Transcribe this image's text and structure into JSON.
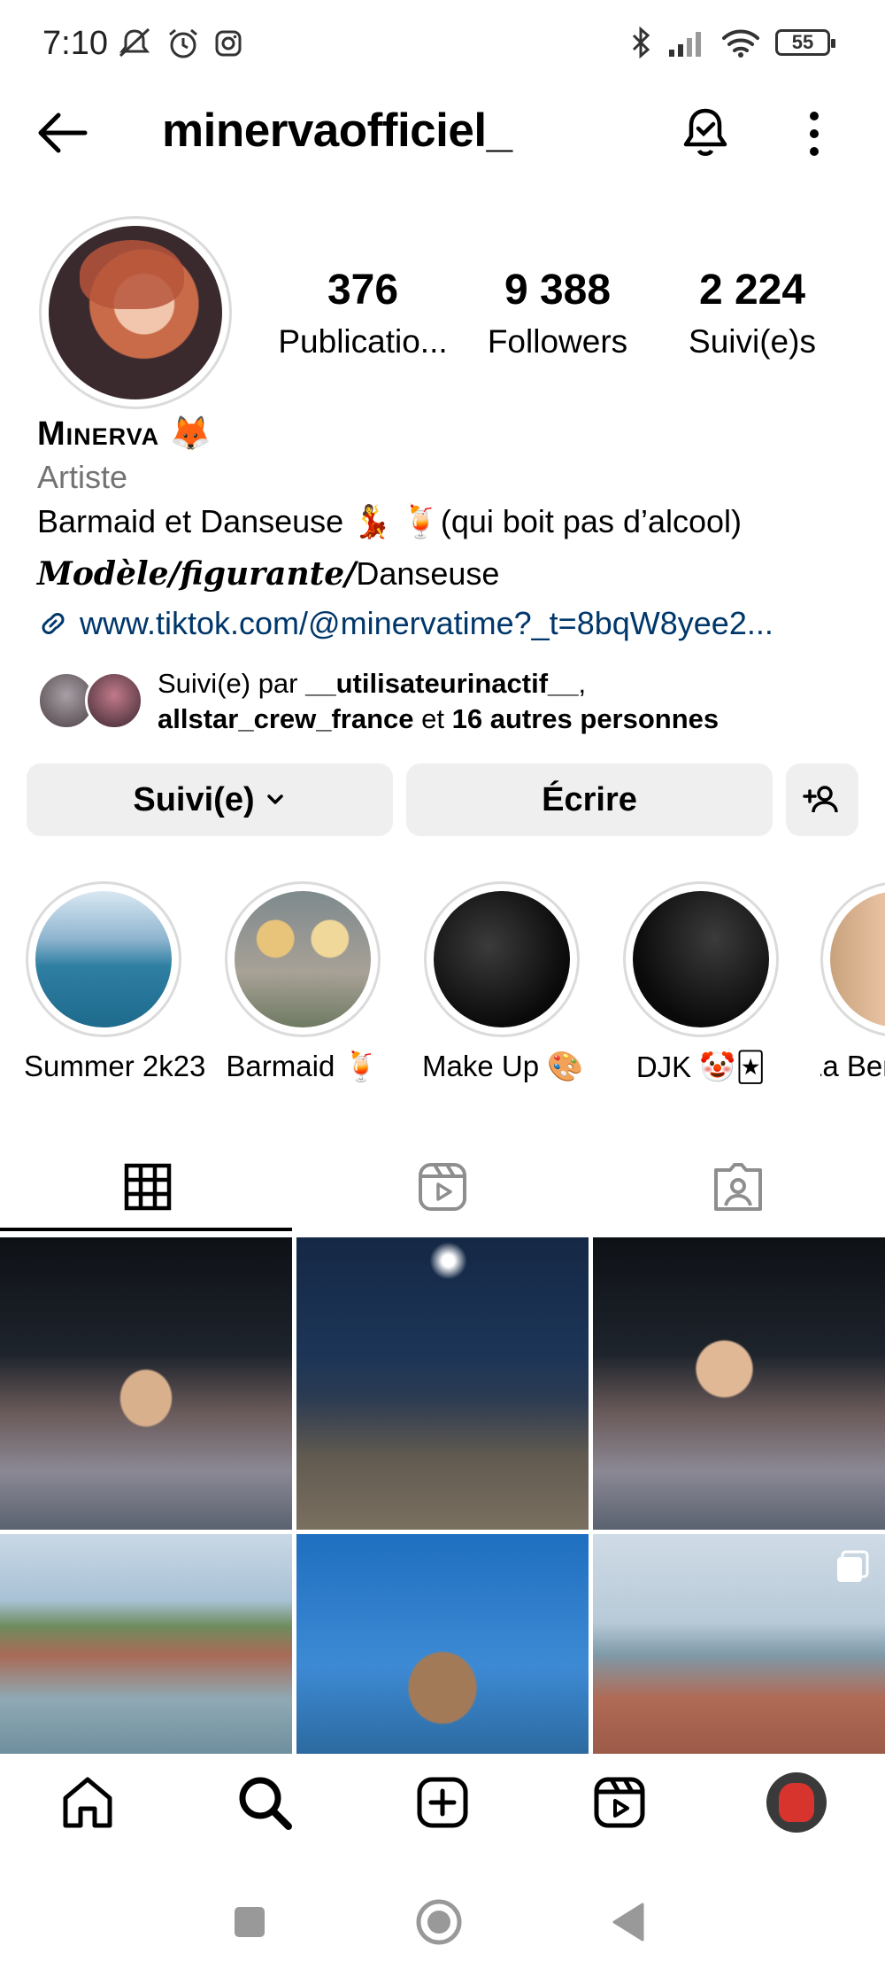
{
  "status_bar": {
    "time": "7:10",
    "battery": "55"
  },
  "header": {
    "username": "minervaofficiel_"
  },
  "stats": [
    {
      "value": "376",
      "label": "Publicatio..."
    },
    {
      "value": "9 388",
      "label": "Followers"
    },
    {
      "value": "2 224",
      "label": "Suivi(e)s"
    }
  ],
  "profile": {
    "display_name": "Minerva 🦊",
    "category": "Artiste",
    "bio_line1": "Barmaid et Danseuse 💃 🍹(qui boit pas d’alcool)",
    "bio_line2_styled": "Modèle/figurante/",
    "bio_line2_plain": "Danseuse",
    "link": "www.tiktok.com/@minervatime?_t=8bqW8yee2..."
  },
  "followed_by": {
    "prefix": "Suivi(e) par ",
    "user1": "__utilisateurinactif__",
    "comma": ",",
    "user2": "allstar_crew_france",
    "mid": " et ",
    "others": "16 autres personnes"
  },
  "buttons": {
    "follow": "Suivi(e)",
    "write": "Écrire"
  },
  "highlights": [
    {
      "label": "Summer 2k23"
    },
    {
      "label": "Barmaid 🍹"
    },
    {
      "label": "Make Up 🎨"
    },
    {
      "label": "DJK 🤡🃏"
    },
    {
      "label": "La Ben"
    }
  ],
  "colors": {
    "link": "#00376b",
    "secondary_text": "#737373",
    "button_bg": "#efefef"
  }
}
